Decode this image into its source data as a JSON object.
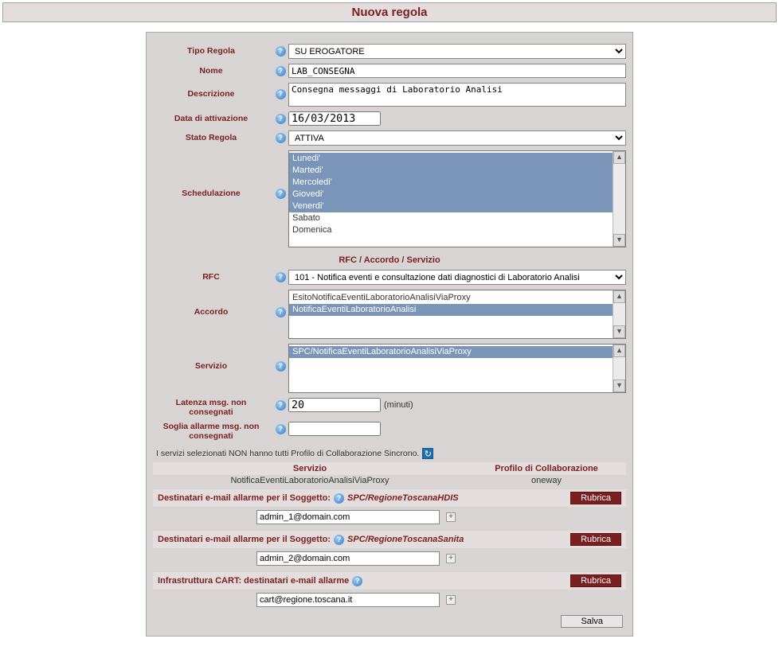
{
  "title": "Nuova regola",
  "fields": {
    "tipo_regola": {
      "label": "Tipo Regola",
      "value": "SU EROGATORE"
    },
    "nome": {
      "label": "Nome",
      "value": "LAB_CONSEGNA"
    },
    "descrizione": {
      "label": "Descrizione",
      "value": "Consegna messaggi di Laboratorio Analisi"
    },
    "data_attivazione": {
      "label": "Data di attivazione",
      "value": "16/03/2013"
    },
    "stato_regola": {
      "label": "Stato Regola",
      "value": "ATTIVA"
    },
    "schedulazione": {
      "label": "Schedulazione",
      "items": [
        {
          "text": "Lunedi'",
          "selected": true
        },
        {
          "text": "Martedi'",
          "selected": true
        },
        {
          "text": "Mercoledi'",
          "selected": true
        },
        {
          "text": "Giovedi'",
          "selected": true
        },
        {
          "text": "Venerdi'",
          "selected": true
        },
        {
          "text": "Sabato",
          "selected": false
        },
        {
          "text": "Domenica",
          "selected": false
        }
      ]
    },
    "section_rfc": "RFC / Accordo / Servizio",
    "rfc": {
      "label": "RFC",
      "value": "101 - Notifica eventi e consultazione dati diagnostici di Laboratorio Analisi"
    },
    "accordo": {
      "label": "Accordo",
      "items": [
        {
          "text": "EsitoNotificaEventiLaboratorioAnalisiViaProxy",
          "selected": false
        },
        {
          "text": "NotificaEventiLaboratorioAnalisi",
          "selected": true
        }
      ]
    },
    "servizio": {
      "label": "Servizio",
      "items": [
        {
          "text": "SPC/NotificaEventiLaboratorioAnalisiViaProxy",
          "selected": true
        }
      ]
    },
    "latenza": {
      "label": "Latenza msg. non consegnati",
      "value": "20",
      "unit": "(minuti)"
    },
    "soglia": {
      "label": "Soglia allarme msg. non consegnati",
      "value": ""
    }
  },
  "note": "I servizi selezionati NON hanno tutti Profilo di Collaborazione Sincrono.",
  "table": {
    "h1": "Servizio",
    "h2": "Profilo di Collaborazione",
    "row": {
      "servizio": "NotificaEventiLaboratorioAnalisiViaProxy",
      "profilo": "oneway"
    }
  },
  "dest": {
    "label_prefix": "Destinatari e-mail allarme per il Soggetto:",
    "rubrica": "Rubrica",
    "groups": [
      {
        "subject": "SPC/RegioneToscanaHDIS",
        "email": "admin_1@domain.com"
      },
      {
        "subject": "SPC/RegioneToscanaSanita",
        "email": "admin_2@domain.com"
      }
    ],
    "infra": {
      "label": "Infrastruttura CART: destinatari e-mail allarme",
      "email": "cart@regione.toscana.it"
    }
  },
  "save": "Salva"
}
